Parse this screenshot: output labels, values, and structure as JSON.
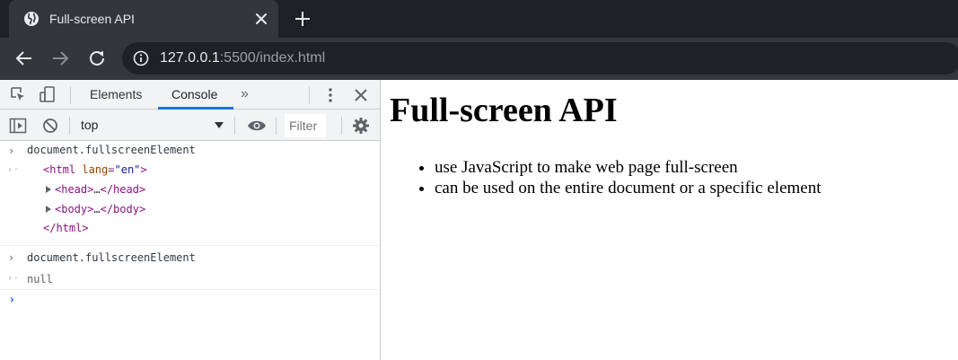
{
  "browser": {
    "tab": {
      "title": "Full-screen API",
      "favicon": "globe-icon"
    },
    "address": {
      "host": "127.0.0.1",
      "rest": ":5500/index.html"
    }
  },
  "devtools": {
    "tabs": [
      {
        "label": "Elements",
        "active": false
      },
      {
        "label": "Console",
        "active": true
      }
    ],
    "console": {
      "context": "top",
      "filter_placeholder": "Filter",
      "commands": [
        {
          "input": "document.fullscreenElement"
        },
        {
          "input": "document.fullscreenElement",
          "output": "null"
        }
      ],
      "html_tree": {
        "open_tag": "<html",
        "attr_name": "lang",
        "attr_eq": "=",
        "attr_value": "\"en\"",
        "close_bracket": ">",
        "head_open": "<head>",
        "ellipsis": "…",
        "head_close": "</head>",
        "body_open": "<body>",
        "body_close": "</body>",
        "html_close": "</html>"
      }
    }
  },
  "page": {
    "heading": "Full-screen API",
    "items": [
      "use JavaScript to make web page full-screen",
      "can be used on the entire document or a specific element"
    ]
  },
  "colors": {
    "chrome_dark": "#202124",
    "chrome_tab": "#35363a",
    "accent": "#1a73e8",
    "devtools_bar": "#f1f3f4"
  }
}
